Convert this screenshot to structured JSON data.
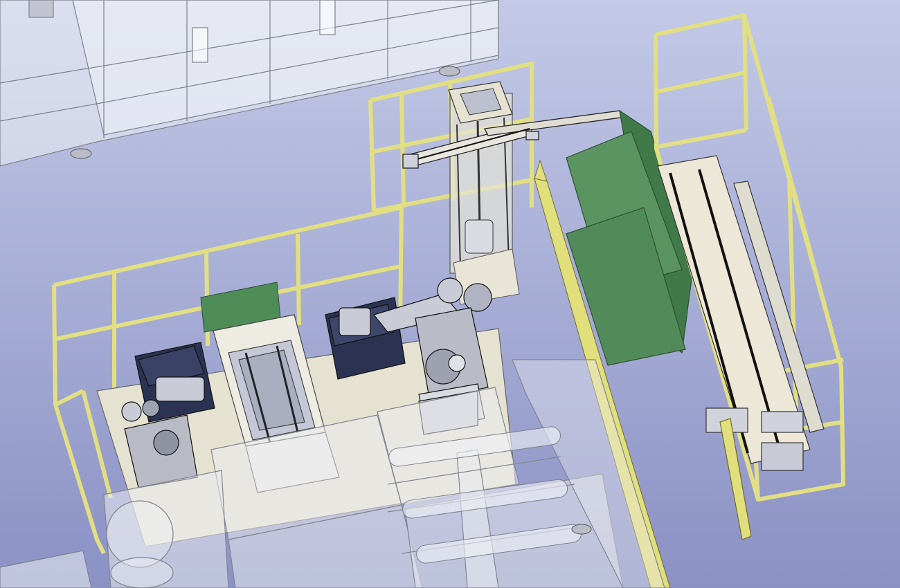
{
  "viewport": {
    "background_top": "#c3c9e6",
    "background_bottom": "#8a91c4"
  },
  "colors": {
    "safety_fence": "#e2df82",
    "fence_stroke": "#8f8c3c",
    "green_panel": "#4f8d58",
    "robot_dark": "#2c3352",
    "robot_light": "#c9ccd6",
    "base_plate": "#e6e2d2",
    "transparent_housing": "#e9ebef"
  }
}
